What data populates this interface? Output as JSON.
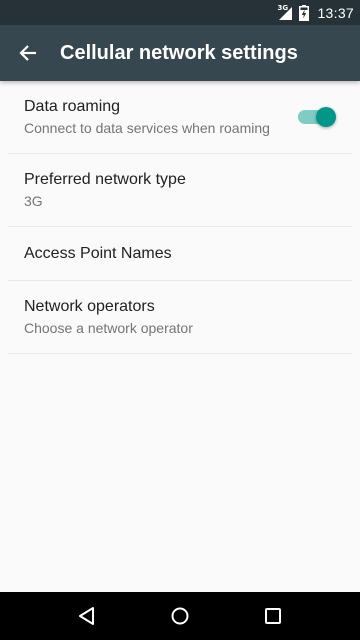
{
  "status_bar": {
    "network_type": "3G",
    "time": "13:37",
    "icons": [
      "signal-icon",
      "battery-charging-icon"
    ]
  },
  "app_bar": {
    "title": "Cellular network settings",
    "back_icon": "back-arrow-icon"
  },
  "preferences": [
    {
      "title": "Data roaming",
      "summary": "Connect to data services when roaming",
      "toggle_on": true
    },
    {
      "title": "Preferred network type",
      "summary": "3G"
    },
    {
      "title": "Access Point Names"
    },
    {
      "title": "Network operators",
      "summary": "Choose a network operator"
    }
  ],
  "nav_bar": {
    "icons": [
      "back-triangle-icon",
      "home-circle-icon",
      "recents-square-icon"
    ]
  },
  "colors": {
    "status_bar": "#263238",
    "app_bar": "#37474f",
    "accent": "#009688",
    "accent_track": "#80cbc4",
    "background": "#fafafa"
  }
}
